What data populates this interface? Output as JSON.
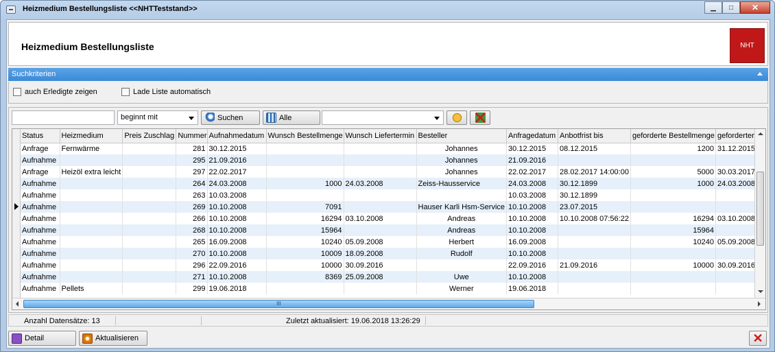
{
  "window": {
    "title": "Heizmedium Bestellungsliste  <<NHTTeststand>>",
    "minimize": "▁",
    "maximize": "□",
    "close": "✕"
  },
  "header": {
    "title": "Heizmedium Bestellungsliste",
    "logo_text": "NHT"
  },
  "search_criteria": {
    "label": "Suchkriterien",
    "show_done": "auch Erledigte zeigen",
    "auto_load": "Lade Liste automatisch"
  },
  "toolbar": {
    "search_value": "",
    "match_mode": "beginnt mit",
    "search_button": "Suchen",
    "all_button": "Alle",
    "filter_value": ""
  },
  "table": {
    "columns": [
      "Status",
      "Heizmedium",
      "Preis Zuschlag",
      "Nummer",
      "Aufnahmedatum",
      "Wunsch Bestellmenge",
      "Wunsch Liefertermin",
      "Besteller",
      "Anfragedatum",
      "Anbotfrist bis",
      "geforderte Bestellmenge",
      "geforderter L"
    ],
    "rows": [
      [
        "Anfrage",
        "Fernwärme",
        "",
        "281",
        "30.12.2015",
        "",
        "",
        "Johannes",
        "30.12.2015",
        "08.12.2015",
        "1200",
        "31.12.2015"
      ],
      [
        "Aufnahme",
        "",
        "",
        "295",
        "21.09.2016",
        "",
        "",
        "Johannes",
        "21.09.2016",
        "",
        "",
        ""
      ],
      [
        "Anfrage",
        "Heizöl extra leicht",
        "",
        "297",
        "22.02.2017",
        "",
        "",
        "Johannes",
        "22.02.2017",
        "28.02.2017 14:00:00",
        "5000",
        "30.03.2017"
      ],
      [
        "Aufnahme",
        "",
        "",
        "264",
        "24.03.2008",
        "1000",
        "24.03.2008",
        "Zeiss-Hausservice",
        "24.03.2008",
        "30.12.1899",
        "1000",
        "24.03.2008"
      ],
      [
        "Aufnahme",
        "",
        "",
        "263",
        "10.03.2008",
        "",
        "",
        "",
        "10.03.2008",
        "30.12.1899",
        "",
        ""
      ],
      [
        "Aufnahme",
        "",
        "",
        "269",
        "10.10.2008",
        "7091",
        "",
        "Hauser Karli Hsm-Service",
        "10.10.2008",
        "23.07.2015",
        "",
        ""
      ],
      [
        "Aufnahme",
        "",
        "",
        "266",
        "10.10.2008",
        "16294",
        "03.10.2008",
        "Andreas",
        "10.10.2008",
        "10.10.2008 07:56:22",
        "16294",
        "03.10.2008"
      ],
      [
        "Aufnahme",
        "",
        "",
        "268",
        "10.10.2008",
        "15964",
        "",
        "Andreas",
        "10.10.2008",
        "",
        "15964",
        ""
      ],
      [
        "Aufnahme",
        "",
        "",
        "265",
        "16.09.2008",
        "10240",
        "05.09.2008",
        "Herbert",
        "16.09.2008",
        "",
        "10240",
        "05.09.2008"
      ],
      [
        "Aufnahme",
        "",
        "",
        "270",
        "10.10.2008",
        "10009",
        "18.09.2008",
        "Rudolf",
        "10.10.2008",
        "",
        "",
        ""
      ],
      [
        "Aufnahme",
        "",
        "",
        "296",
        "22.09.2016",
        "10000",
        "30.09.2016",
        "",
        "22.09.2016",
        "21.09.2016",
        "10000",
        "30.09.2016"
      ],
      [
        "Aufnahme",
        "",
        "",
        "271",
        "10.10.2008",
        "8369",
        "25.09.2008",
        "Uwe",
        "10.10.2008",
        "",
        "",
        ""
      ],
      [
        "Aufnahme",
        "Pellets",
        "",
        "299",
        "19.06.2018",
        "",
        "",
        "Werner",
        "19.06.2018",
        "",
        "",
        ""
      ]
    ],
    "selected_row": 5,
    "scroll_grip": "III"
  },
  "status": {
    "count": "Anzahl Datensätze: 13",
    "updated": "Zuletzt aktualisiert: 19.06.2018 13:26:29"
  },
  "buttons": {
    "detail": "Detail",
    "refresh": "Aktualisieren"
  },
  "colors": {
    "accent": "#3a8ad8",
    "logo": "#c01818",
    "row_alt": "#e6f0fa"
  }
}
